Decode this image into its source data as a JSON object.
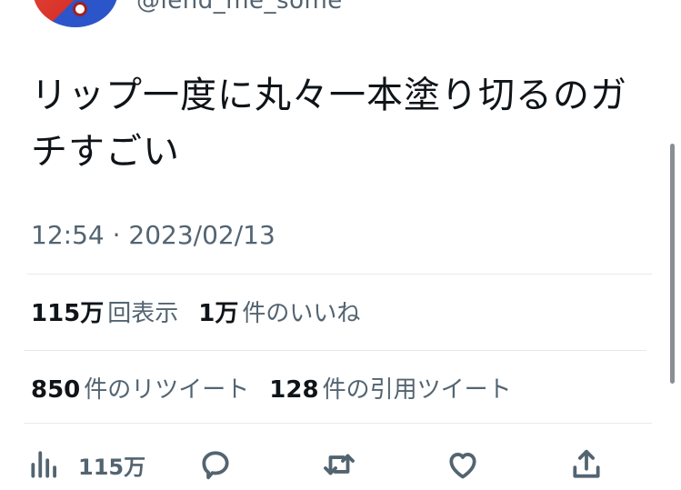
{
  "header": {
    "handle": "@lend_me_some"
  },
  "tweet": {
    "text_line1": "リップ一度に丸々一本塗り切るのガ",
    "text_line2": "チすごい",
    "time": "12:54",
    "separator": "·",
    "date": "2023/02/13"
  },
  "stats": {
    "views_count": "115万",
    "views_label": "回表示",
    "likes_count": "1万",
    "likes_label": "件のいいね",
    "retweets_count": "850",
    "retweets_label": "件のリツイート",
    "quotes_count": "128",
    "quotes_label": "件の引用ツイート"
  },
  "actions": {
    "views_count": "115万",
    "icons": [
      "analytics-icon",
      "reply-icon",
      "retweet-icon",
      "like-icon",
      "share-icon"
    ]
  },
  "colors": {
    "text": "#0f1419",
    "secondary": "#536471",
    "divider": "#e6e9ec"
  }
}
